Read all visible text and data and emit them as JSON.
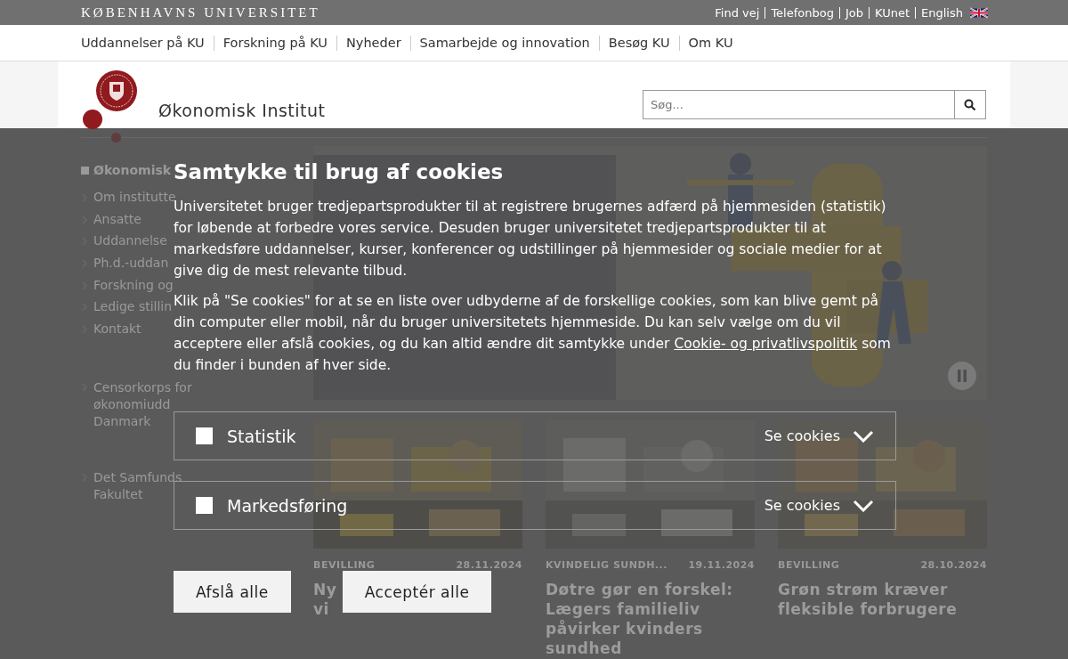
{
  "top_bar": {
    "wordmark": "KØBENHAVNS UNIVERSITET",
    "links": [
      "Find vej",
      "Telefonbog",
      "Job",
      "KUnet",
      "English"
    ]
  },
  "main_nav": [
    "Uddannelser på KU",
    "Forskning på KU",
    "Nyheder",
    "Samarbejde og innovation",
    "Besøg KU",
    "Om KU"
  ],
  "header": {
    "title": "Økonomisk Institut",
    "search": {
      "placeholder": "Søg..."
    }
  },
  "sidebar": {
    "heading": "Økonomisk",
    "items": [
      "Om institutte",
      "Ansatte",
      "Uddannelse",
      "Ph.d.-uddan",
      "Forskning og",
      "Ledige stillin",
      "Kontakt"
    ],
    "links": [
      {
        "lines": [
          "Censorkorps for",
          "økonomiudd",
          "Danmark"
        ]
      },
      {
        "lines": [
          "Det Samfunds",
          "Fakultet"
        ]
      }
    ]
  },
  "news": [
    {
      "category": "BEVILLING",
      "date": "28.11.2024",
      "title_lines": [
        "Ny",
        "vi"
      ]
    },
    {
      "category": "KVINDELIG SUNDH...",
      "date": "19.11.2024",
      "title_lines": [
        "Døtre gør en forskel:",
        "Lægers familieliv",
        "påvirker kvinders",
        "sundhed"
      ]
    },
    {
      "category": "BEVILLING",
      "date": "28.10.2024",
      "title_lines": [
        "Grøn strøm kræver",
        "fleksible forbrugere"
      ]
    }
  ],
  "cookie_dialog": {
    "title": "Samtykke til brug af cookies",
    "intro": "Universitetet bruger tredjepartsprodukter til at registrere brugernes adfærd på hjemmesiden (statistik) for løbende at forbedre vores service. Desuden bruger universitetet tredjepartsprodukter til at markedsføre uddannelser, kurser, konferencer og udstillinger på hjemmesider og sociale medier for at give dig de mest relevante tilbud.",
    "details": {
      "before": "Klik på \"Se cookies\" for at se en liste over udbyderne af de forskellige cookies, som kan blive gemt på din computer eller mobil, når du bruger universitetets hjemmeside. Du kan selv vælge om du vil acceptere eller afslå cookies, og du kan altid ændre dit samtykke under",
      "link": "Cookie- og privatlivspolitik",
      "after": "som du finder i bunden af hver side."
    },
    "categories": [
      {
        "label": "Statistik",
        "checked": false,
        "action": "Se cookies",
        "expanded": false
      },
      {
        "label": "Markedsføring",
        "checked": false,
        "action": "Se cookies",
        "expanded": false
      }
    ],
    "buttons": [
      "Afslå alle",
      "Acceptér alle"
    ]
  }
}
